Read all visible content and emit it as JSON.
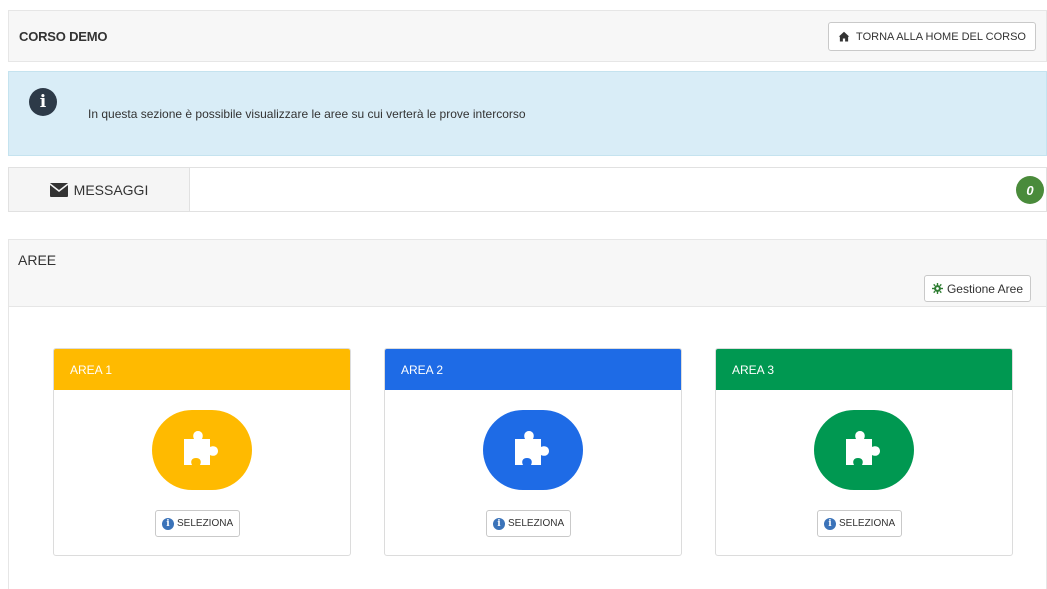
{
  "header": {
    "title": "CORSO DEMO",
    "home_button": "TORNA ALLA HOME DEL CORSO"
  },
  "info": {
    "text": "In questa sezione è possibile visualizzare le aree su cui verterà le prove intercorso"
  },
  "messages": {
    "label": "MESSAGGI",
    "count": "0"
  },
  "areas_panel": {
    "title": "AREE",
    "manage_button": "Gestione Aree",
    "cards": [
      {
        "title": "AREA 1",
        "color": "#ffba00",
        "button": "SELEZIONA"
      },
      {
        "title": "AREA 2",
        "color": "#1e6be6",
        "button": "SELEZIONA"
      },
      {
        "title": "AREA 3",
        "color": "#009851",
        "button": "SELEZIONA"
      }
    ]
  },
  "icons": {
    "home": "home-icon",
    "info": "info-icon",
    "envelope": "envelope-icon",
    "gear": "gear-icon",
    "puzzle": "puzzle-icon"
  }
}
